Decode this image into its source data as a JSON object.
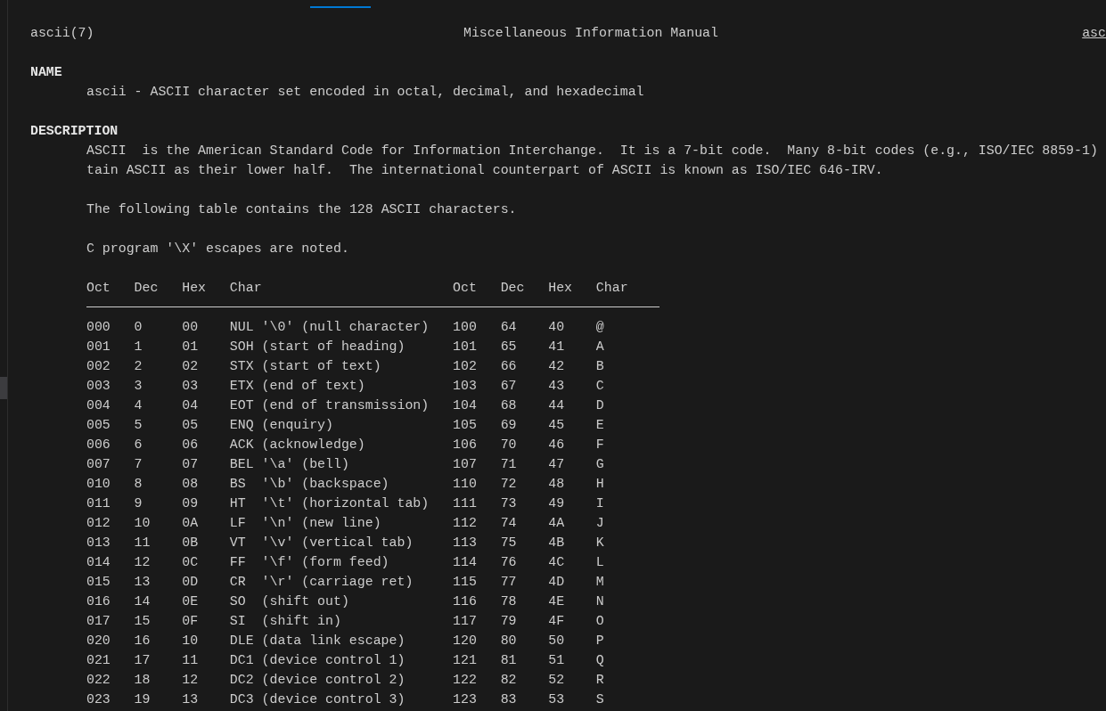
{
  "header": {
    "left": "ascii(7)",
    "center": "Miscellaneous Information Manual",
    "right": "asc"
  },
  "sections": [
    {
      "heading": "NAME",
      "paragraphs": [
        [
          "ascii - ASCII character set encoded in octal, decimal, and hexadecimal"
        ]
      ]
    },
    {
      "heading": "DESCRIPTION",
      "paragraphs": [
        [
          "ASCII  is the American Standard Code for Information Interchange.  It is a 7-bit code.  Many 8-bit codes (e.g., ISO/IEC 8859-1)",
          "tain ASCII as their lower half.  The international counterpart of ASCII is known as ISO/IEC 646-IRV."
        ],
        [
          "The following table contains the 128 ASCII characters."
        ],
        [
          "C program '\\X' escapes are noted."
        ]
      ]
    }
  ],
  "table": {
    "columns": [
      "Oct",
      "Dec",
      "Hex",
      "Char",
      "Oct",
      "Dec",
      "Hex",
      "Char"
    ],
    "rows": [
      [
        "000",
        "0",
        "00",
        "NUL '\\0' (null character)",
        "100",
        "64",
        "40",
        "@"
      ],
      [
        "001",
        "1",
        "01",
        "SOH (start of heading)",
        "101",
        "65",
        "41",
        "A"
      ],
      [
        "002",
        "2",
        "02",
        "STX (start of text)",
        "102",
        "66",
        "42",
        "B"
      ],
      [
        "003",
        "3",
        "03",
        "ETX (end of text)",
        "103",
        "67",
        "43",
        "C"
      ],
      [
        "004",
        "4",
        "04",
        "EOT (end of transmission)",
        "104",
        "68",
        "44",
        "D"
      ],
      [
        "005",
        "5",
        "05",
        "ENQ (enquiry)",
        "105",
        "69",
        "45",
        "E"
      ],
      [
        "006",
        "6",
        "06",
        "ACK (acknowledge)",
        "106",
        "70",
        "46",
        "F"
      ],
      [
        "007",
        "7",
        "07",
        "BEL '\\a' (bell)",
        "107",
        "71",
        "47",
        "G"
      ],
      [
        "010",
        "8",
        "08",
        "BS  '\\b' (backspace)",
        "110",
        "72",
        "48",
        "H"
      ],
      [
        "011",
        "9",
        "09",
        "HT  '\\t' (horizontal tab)",
        "111",
        "73",
        "49",
        "I"
      ],
      [
        "012",
        "10",
        "0A",
        "LF  '\\n' (new line)",
        "112",
        "74",
        "4A",
        "J"
      ],
      [
        "013",
        "11",
        "0B",
        "VT  '\\v' (vertical tab)",
        "113",
        "75",
        "4B",
        "K"
      ],
      [
        "014",
        "12",
        "0C",
        "FF  '\\f' (form feed)",
        "114",
        "76",
        "4C",
        "L"
      ],
      [
        "015",
        "13",
        "0D",
        "CR  '\\r' (carriage ret)",
        "115",
        "77",
        "4D",
        "M"
      ],
      [
        "016",
        "14",
        "0E",
        "SO  (shift out)",
        "116",
        "78",
        "4E",
        "N"
      ],
      [
        "017",
        "15",
        "0F",
        "SI  (shift in)",
        "117",
        "79",
        "4F",
        "O"
      ],
      [
        "020",
        "16",
        "10",
        "DLE (data link escape)",
        "120",
        "80",
        "50",
        "P"
      ],
      [
        "021",
        "17",
        "11",
        "DC1 (device control 1)",
        "121",
        "81",
        "51",
        "Q"
      ],
      [
        "022",
        "18",
        "12",
        "DC2 (device control 2)",
        "122",
        "82",
        "52",
        "R"
      ],
      [
        "023",
        "19",
        "13",
        "DC3 (device control 3)",
        "123",
        "83",
        "53",
        "S"
      ]
    ]
  }
}
